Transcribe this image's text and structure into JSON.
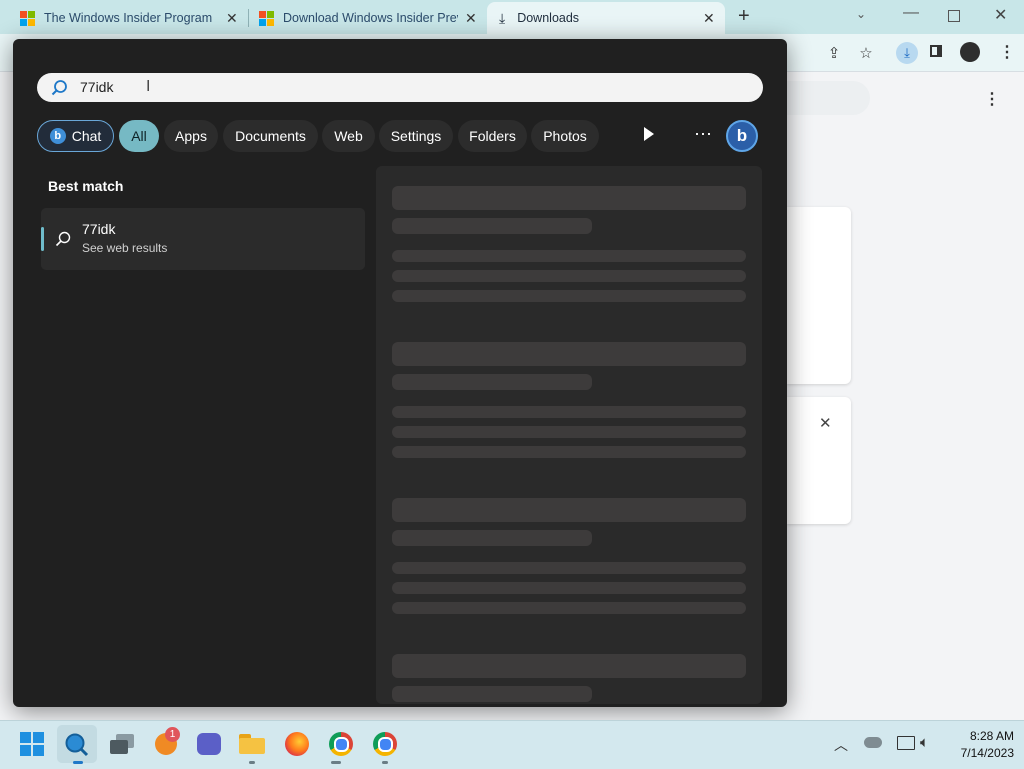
{
  "browser": {
    "tabs": [
      {
        "title": "The Windows Insider Program"
      },
      {
        "title": "Download Windows Insider Previ"
      },
      {
        "title": "Downloads"
      }
    ],
    "new_tab": "+"
  },
  "search": {
    "query": "77idk",
    "chips": [
      "Chat",
      "All",
      "Apps",
      "Documents",
      "Web",
      "Settings",
      "Folders",
      "Photos"
    ],
    "more": "⋯"
  },
  "results": {
    "section": "Best match",
    "top": {
      "title": "77idk",
      "subtitle": "See web results"
    }
  },
  "taskbar": {
    "time": "8:28 AM",
    "date": "7/14/2023",
    "badge": "1"
  },
  "colors": {
    "accent": "#76b9c4",
    "panel": "#202020",
    "taskbar": "#d3e8ee"
  }
}
